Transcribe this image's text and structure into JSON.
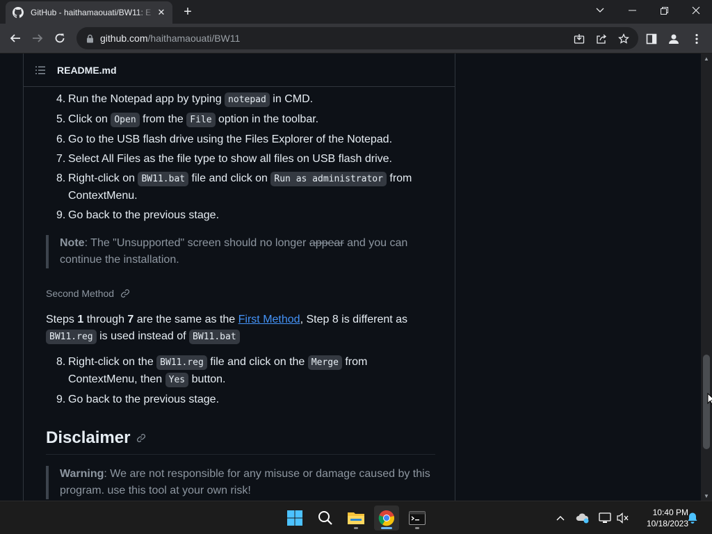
{
  "browser": {
    "tab_title": "GitHub - haithamaouati/BW11: E",
    "url_host": "github.com",
    "url_path": "/haithamaouati/BW11"
  },
  "readme": {
    "filename": "README.md",
    "steps_a": [
      {
        "num": "4.",
        "parts": [
          {
            "t": "Run the Notepad app by typing "
          },
          {
            "c": "notepad"
          },
          {
            "t": " in CMD."
          }
        ]
      },
      {
        "num": "5.",
        "parts": [
          {
            "t": "Click on "
          },
          {
            "c": "Open"
          },
          {
            "t": " from the "
          },
          {
            "c": "File"
          },
          {
            "t": " option in the toolbar."
          }
        ]
      },
      {
        "num": "6.",
        "parts": [
          {
            "t": "Go to the USB flash drive using the Files Explorer of the Notepad."
          }
        ]
      },
      {
        "num": "7.",
        "parts": [
          {
            "t": "Select All Files as the file type to show all files on USB flash drive."
          }
        ]
      },
      {
        "num": "8.",
        "parts": [
          {
            "t": "Right-click on "
          },
          {
            "c": "BW11.bat"
          },
          {
            "t": " file and click on "
          },
          {
            "c": "Run as administrator"
          },
          {
            "t": " from ContextMenu."
          }
        ]
      },
      {
        "num": "9.",
        "parts": [
          {
            "t": "Go back to the previous stage."
          }
        ]
      }
    ],
    "note": {
      "label": "Note",
      "text_before": ": The \"Unsupported\" screen should no longer ",
      "struck": "appear",
      "text_after": " and you can continue the installation."
    },
    "second_method": {
      "heading": "Second Method",
      "intro": [
        {
          "t": "Steps "
        },
        {
          "b": "1"
        },
        {
          "t": " through "
        },
        {
          "b": "7"
        },
        {
          "t": " are the same as the "
        },
        {
          "l": "First Method"
        },
        {
          "t": ", Step 8 is different as "
        },
        {
          "c": "BW11.reg"
        },
        {
          "t": " is used instead of "
        },
        {
          "c": "BW11.bat"
        }
      ],
      "steps": [
        {
          "num": "8.",
          "parts": [
            {
              "t": "Right-click on the "
            },
            {
              "c": "BW11.reg"
            },
            {
              "t": " file and click on the "
            },
            {
              "c": "Merge"
            },
            {
              "t": " from ContextMenu, then "
            },
            {
              "c": "Yes"
            },
            {
              "t": " button."
            }
          ]
        },
        {
          "num": "9.",
          "parts": [
            {
              "t": "Go back to the previous stage."
            }
          ]
        }
      ]
    },
    "disclaimer": {
      "heading": "Disclaimer",
      "label": "Warning",
      "text": ": We are not responsible for any misuse or damage caused by this program. use this tool at your own risk!"
    }
  },
  "taskbar": {
    "time": "10:40 PM",
    "date": "10/18/2023"
  },
  "icons": [
    "github-icon",
    "close-icon",
    "plus-icon",
    "chevron-down-icon",
    "minimize-icon",
    "restore-icon",
    "window-close-icon",
    "back-icon",
    "forward-icon",
    "reload-icon",
    "lock-icon",
    "install-icon",
    "share-icon",
    "star-icon",
    "side-panel-icon",
    "profile-icon",
    "more-icon",
    "list-icon",
    "link-icon",
    "windows-start-icon",
    "search-icon",
    "file-explorer-icon",
    "chrome-icon",
    "terminal-icon",
    "chevron-up-icon",
    "onedrive-icon",
    "network-icon",
    "volume-icon",
    "bell-icon"
  ]
}
